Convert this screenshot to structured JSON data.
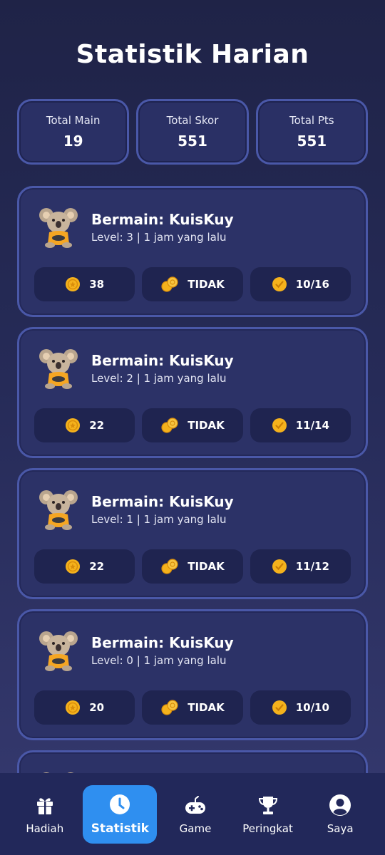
{
  "page_title": "Statistik Harian",
  "summary": [
    {
      "label": "Total Main",
      "value": "19"
    },
    {
      "label": "Total Skor",
      "value": "551"
    },
    {
      "label": "Total Pts",
      "value": "551"
    }
  ],
  "sessions": [
    {
      "title": "Bermain: KuisKuy",
      "subtitle": "Level: 3 | 1 jam yang lalu",
      "coins": "38",
      "bonus": "TIDAK",
      "correct": "10/16"
    },
    {
      "title": "Bermain: KuisKuy",
      "subtitle": "Level: 2 | 1 jam yang lalu",
      "coins": "22",
      "bonus": "TIDAK",
      "correct": "11/14"
    },
    {
      "title": "Bermain: KuisKuy",
      "subtitle": "Level: 1 | 1 jam yang lalu",
      "coins": "22",
      "bonus": "TIDAK",
      "correct": "11/12"
    },
    {
      "title": "Bermain: KuisKuy",
      "subtitle": "Level: 0 | 1 jam yang lalu",
      "coins": "20",
      "bonus": "TIDAK",
      "correct": "10/10"
    }
  ],
  "nav": [
    {
      "label": "Hadiah",
      "icon": "gift-icon"
    },
    {
      "label": "Statistik",
      "icon": "clock-icon",
      "active": true
    },
    {
      "label": "Game",
      "icon": "gamepad-icon"
    },
    {
      "label": "Peringkat",
      "icon": "trophy-icon"
    },
    {
      "label": "Saya",
      "icon": "user-icon"
    }
  ],
  "colors": {
    "accent": "#2f8ff0",
    "card_border": "#4a58a8",
    "coin": "#f5b21c"
  }
}
